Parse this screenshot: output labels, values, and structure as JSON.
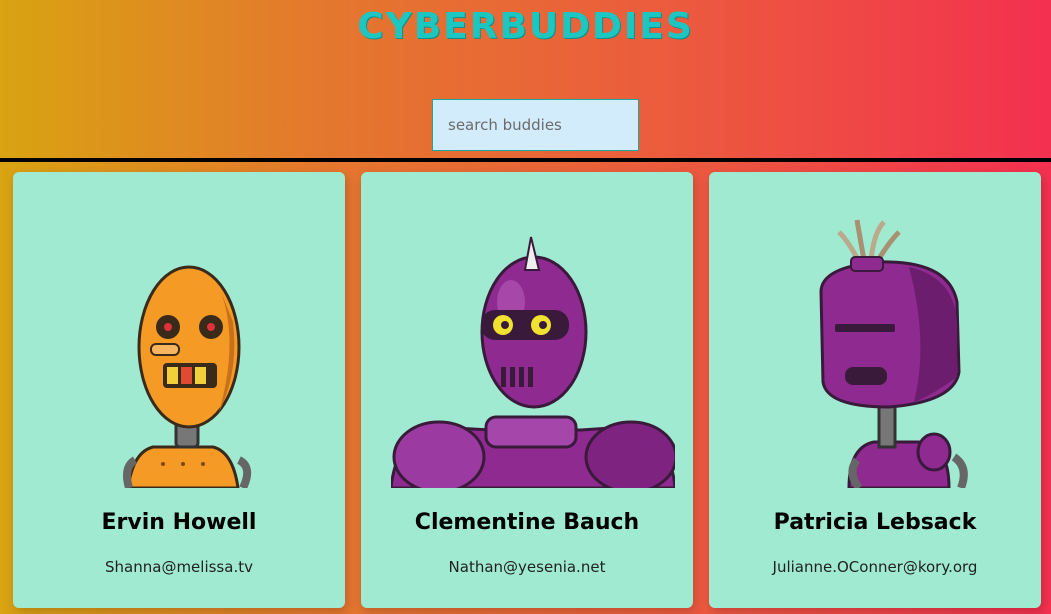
{
  "header": {
    "title": "CYBERBUDDIES",
    "search_placeholder": "search buddies",
    "title_color": "#1bc7c0"
  },
  "robots": [
    {
      "name": "Ervin Howell",
      "email": "Shanna@melissa.tv",
      "avatar": "orange-robot",
      "color": "#f49a25"
    },
    {
      "name": "Clementine Bauch",
      "email": "Nathan@yesenia.net",
      "avatar": "purple-horned-robot",
      "color": "#8e2a90"
    },
    {
      "name": "Patricia Lebsack",
      "email": "Julianne.OConner@kory.org",
      "avatar": "purple-tufted-robot",
      "color": "#8e2a90"
    }
  ],
  "colors": {
    "card_bg": "#9fead1",
    "search_bg": "#d3ecfb"
  }
}
